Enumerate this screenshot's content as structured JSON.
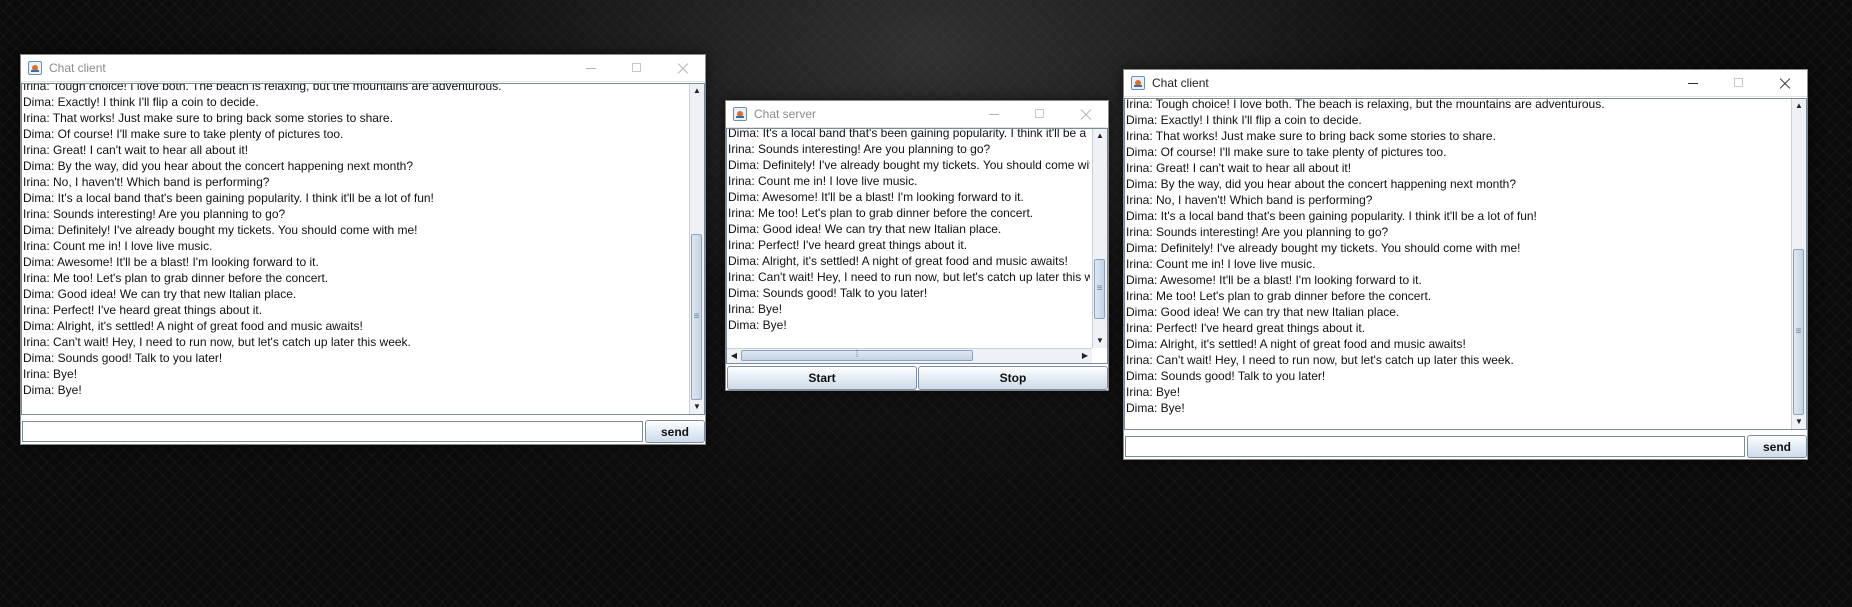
{
  "clients": [
    {
      "title": "Chat client",
      "send_label": "send",
      "input_value": "",
      "messages": [
        "Irina: Tough choice! I love both. The beach is relaxing, but the mountains are adventurous.",
        "Dima: Exactly! I think I'll flip a coin to decide.",
        "Irina: That works! Just make sure to bring back some stories to share.",
        "Dima: Of course! I'll make sure to take plenty of pictures too.",
        "Irina: Great! I can't wait to hear all about it!",
        "Dima: By the way, did you hear about the concert happening next month?",
        "Irina: No, I haven't! Which band is performing?",
        "Dima: It's a local band that's been gaining popularity. I think it'll be a lot of fun!",
        "Irina: Sounds interesting! Are you planning to go?",
        "Dima: Definitely! I've already bought my tickets. You should come with me!",
        "Irina: Count me in! I love live music.",
        "Dima: Awesome! It'll be a blast! I'm looking forward to it.",
        "Irina: Me too! Let's plan to grab dinner before the concert.",
        "Dima: Good idea! We can try that new Italian place.",
        "Irina: Perfect! I've heard great things about it.",
        "Dima: Alright, it's settled! A night of great food and music awaits!",
        "Irina: Can't wait! Hey, I need to run now, but let's catch up later this week.",
        "Dima: Sounds good! Talk to you later!",
        "Irina: Bye!",
        "Dima: Bye!"
      ]
    },
    {
      "title": "Chat client",
      "send_label": "send",
      "input_value": "",
      "messages": [
        "Irina: Tough choice! I love both. The beach is relaxing, but the mountains are adventurous.",
        "Dima: Exactly! I think I'll flip a coin to decide.",
        "Irina: That works! Just make sure to bring back some stories to share.",
        "Dima: Of course! I'll make sure to take plenty of pictures too.",
        "Irina: Great! I can't wait to hear all about it!",
        "Dima: By the way, did you hear about the concert happening next month?",
        "Irina: No, I haven't! Which band is performing?",
        "Dima: It's a local band that's been gaining popularity. I think it'll be a lot of fun!",
        "Irina: Sounds interesting! Are you planning to go?",
        "Dima: Definitely! I've already bought my tickets. You should come with me!",
        "Irina: Count me in! I love live music.",
        "Dima: Awesome! It'll be a blast! I'm looking forward to it.",
        "Irina: Me too! Let's plan to grab dinner before the concert.",
        "Dima: Good idea! We can try that new Italian place.",
        "Irina: Perfect! I've heard great things about it.",
        "Dima: Alright, it's settled! A night of great food and music awaits!",
        "Irina: Can't wait! Hey, I need to run now, but let's catch up later this week.",
        "Dima: Sounds good! Talk to you later!",
        "Irina: Bye!",
        "Dima: Bye!"
      ]
    }
  ],
  "server": {
    "title": "Chat server",
    "start_label": "Start",
    "stop_label": "Stop",
    "messages": [
      "Dima: It's a local band that's been gaining popularity. I think it'll be a lot of fun!",
      "Irina: Sounds interesting! Are you planning to go?",
      "Dima: Definitely! I've already bought my tickets. You should come with me!",
      "Irina: Count me in! I love live music.",
      "Dima: Awesome! It'll be a blast! I'm looking forward to it.",
      "Irina: Me too! Let's plan to grab dinner before the concert.",
      "Dima: Good idea! We can try that new Italian place.",
      "Irina: Perfect! I've heard great things about it.",
      "Dima: Alright, it's settled! A night of great food and music awaits!",
      "Irina: Can't wait! Hey, I need to run now, but let's catch up later this week.",
      "Dima: Sounds good! Talk to you later!",
      "Irina: Bye!",
      "Dima: Bye!"
    ]
  }
}
